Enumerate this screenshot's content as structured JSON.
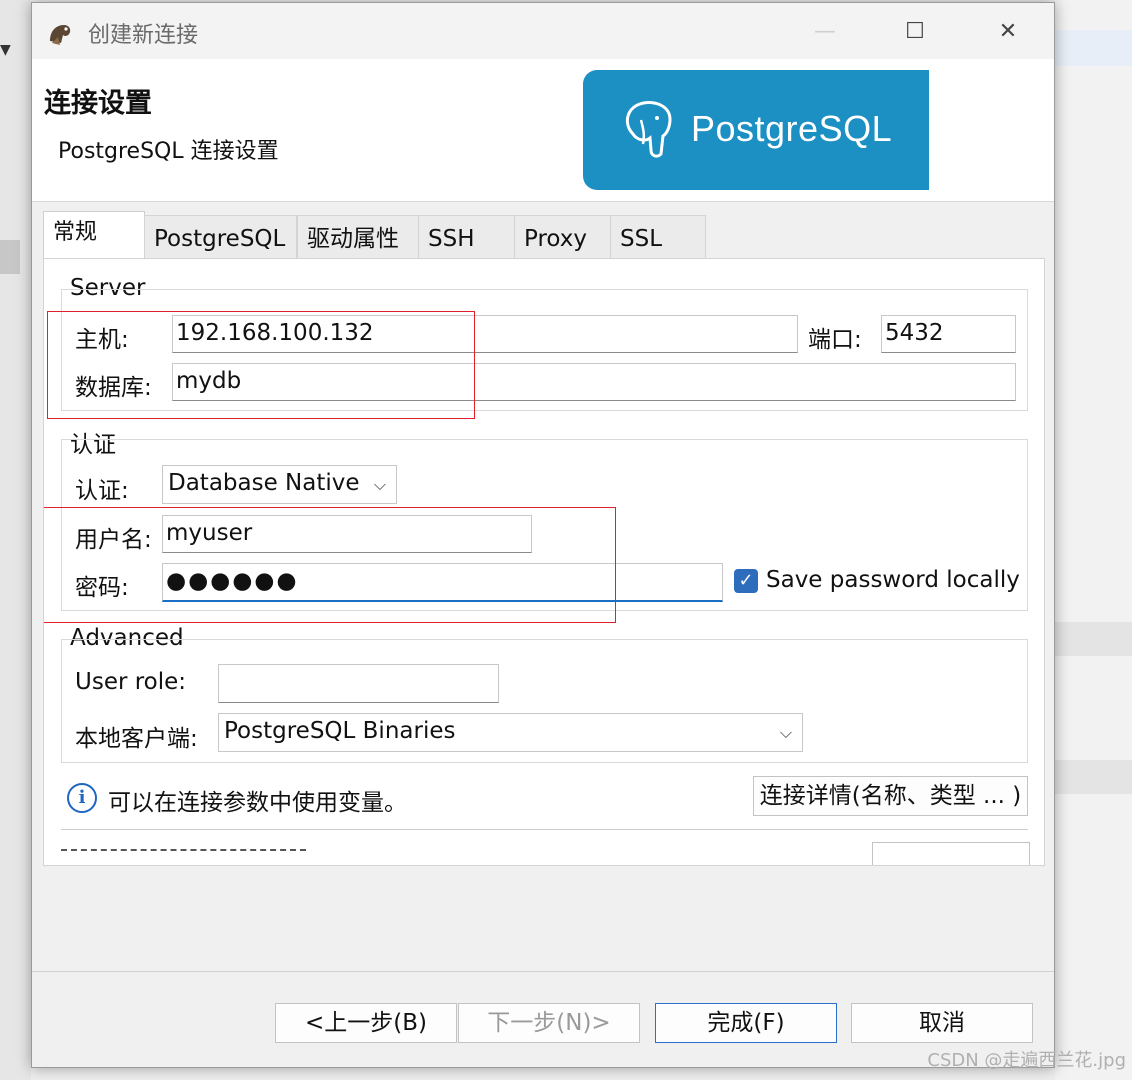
{
  "window": {
    "title": "创建新连接",
    "minimize_glyph": "—",
    "maximize_glyph": "☐",
    "close_glyph": "✕"
  },
  "header": {
    "title": "连接设置",
    "subtitle": "PostgreSQL 连接设置",
    "logo_text": "PostgreSQL",
    "logo_color": "#1c8fc3"
  },
  "tabs": [
    {
      "label": "常规",
      "active": true
    },
    {
      "label": "PostgreSQL"
    },
    {
      "label": "驱动属性"
    },
    {
      "label": "SSH"
    },
    {
      "label": "Proxy"
    },
    {
      "label": "SSL"
    }
  ],
  "server": {
    "group_title": "Server",
    "host_label": "主机:",
    "host_value": "192.168.100.132",
    "port_label": "端口:",
    "port_value": "5432",
    "database_label": "数据库:",
    "database_value": "mydb"
  },
  "auth": {
    "group_title": "认证",
    "auth_label": "认证:",
    "auth_value": "Database Native",
    "username_label": "用户名:",
    "username_value": "myuser",
    "password_label": "密码:",
    "password_value": "●●●●●●",
    "save_password_label": "Save password locally",
    "save_password_checked": true
  },
  "advanced": {
    "group_title": "Advanced",
    "user_role_label": "User role:",
    "user_role_value": "",
    "local_client_label": "本地客户端:",
    "local_client_value": "PostgreSQL Binaries"
  },
  "info": {
    "message": "可以在连接参数中使用变量。",
    "details_button": "连接详情(名称、类型 ... )"
  },
  "buttons": {
    "back": "<上一步(B)",
    "next": "下一步(N)>",
    "finish": "完成(F)",
    "cancel": "取消"
  },
  "watermark": "CSDN @走遍西兰花.jpg",
  "colors": {
    "accent": "#2d6dbc",
    "highlight_red": "#e0202a"
  }
}
